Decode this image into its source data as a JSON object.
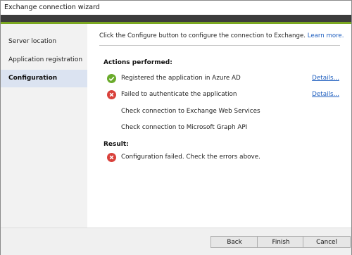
{
  "window": {
    "title": "Exchange connection wizard"
  },
  "sidebar": {
    "items": [
      {
        "label": "Server location"
      },
      {
        "label": "Application registration"
      },
      {
        "label": "Configuration"
      }
    ]
  },
  "main": {
    "instruction": "Click the Configure button to configure the connection to Exchange.",
    "learn_more": "Learn more.",
    "actions_heading": "Actions performed:",
    "actions": [
      {
        "icon": "success-check-icon",
        "label": "Registered the application in Azure AD",
        "details": "Details..."
      },
      {
        "icon": "error-x-icon",
        "label": "Failed to authenticate the application",
        "details": "Details..."
      },
      {
        "icon": "",
        "label": "Check connection to Exchange Web Services",
        "details": ""
      },
      {
        "icon": "",
        "label": "Check connection to Microsoft Graph API",
        "details": ""
      }
    ],
    "result_heading": "Result:",
    "result": {
      "icon": "error-x-icon",
      "label": "Configuration failed. Check the errors above."
    }
  },
  "footer": {
    "back_label": "Back",
    "finish_label": "Finish",
    "cancel_label": "Cancel"
  },
  "colors": {
    "banner_dark": "#3c3c3c",
    "banner_accent": "#7ba821",
    "sidebar_active": "#dbe3f1",
    "success": "#6aab2b",
    "error": "#d9413b",
    "link": "#1f5fbf"
  }
}
